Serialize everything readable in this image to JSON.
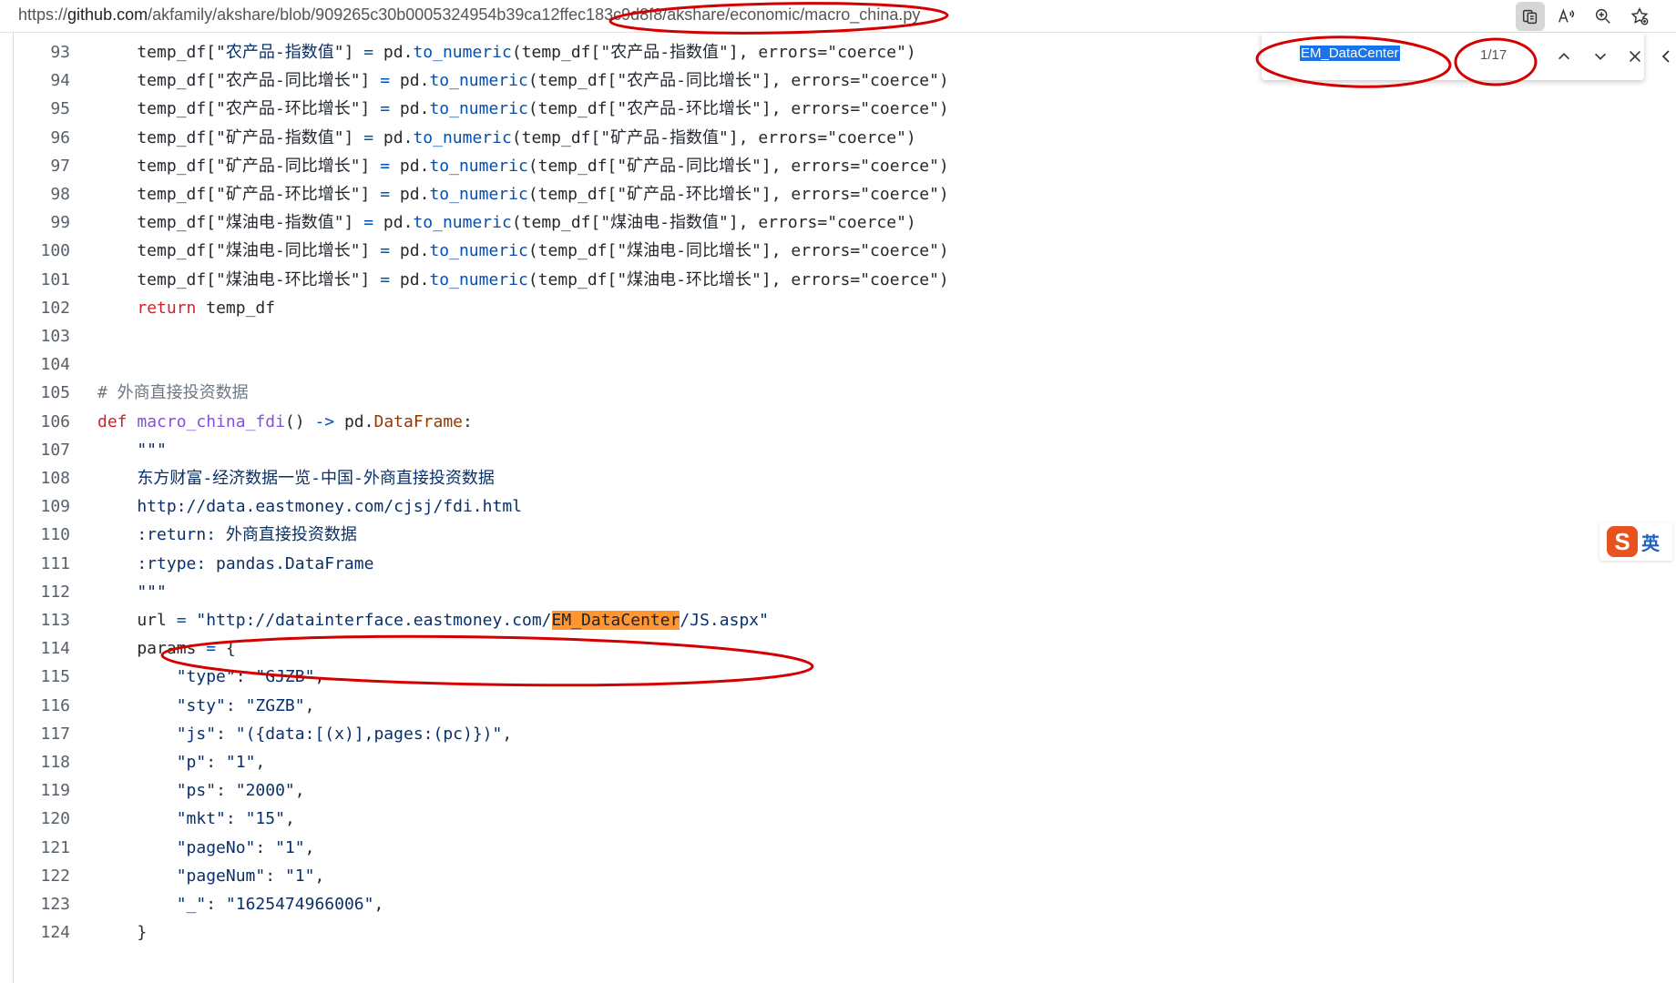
{
  "browser": {
    "url_scheme": "https://",
    "url_host": "github.com",
    "url_path": "/akfamily/akshare/blob/909265c30b0005324954b39ca12ffec183c9d8f8/akshare/economic/macro_china.py",
    "icons": [
      "reader-mode-icon",
      "read-aloud-icon",
      "zoom-icon",
      "favorite-add-icon"
    ]
  },
  "find": {
    "query": "EM_DataCenter",
    "count": "1/17"
  },
  "ime": {
    "logo": "S",
    "lang": "英"
  },
  "colors": {
    "keyword": "#cf222e",
    "function": "#8250df",
    "builtin": "#0550ae",
    "string": "#0a3069",
    "match_highlight": "#ff9632",
    "annotation": "#d40000"
  },
  "code": [
    {
      "n": "93",
      "t": [
        [
          "",
          "    temp_df[\""
        ],
        [
          "str",
          "农产品-指数值"
        ],
        [
          "",
          "\"] "
        ],
        [
          "op",
          "="
        ],
        [
          "",
          " pd."
        ],
        [
          "bi",
          "to_numeric"
        ],
        [
          "",
          "(temp_df[\"农产品-指数值\"], errors=\"coerce\")"
        ]
      ]
    },
    {
      "n": "94",
      "t": [
        [
          "",
          "    temp_df[\"农产品-同比增长\"] "
        ],
        [
          "op",
          "="
        ],
        [
          "",
          " pd."
        ],
        [
          "bi",
          "to_numeric"
        ],
        [
          "",
          "(temp_df[\"农产品-同比增长\"], errors=\"coerce\")"
        ]
      ]
    },
    {
      "n": "95",
      "t": [
        [
          "",
          "    temp_df[\"农产品-环比增长\"] "
        ],
        [
          "op",
          "="
        ],
        [
          "",
          " pd."
        ],
        [
          "bi",
          "to_numeric"
        ],
        [
          "",
          "(temp_df[\"农产品-环比增长\"], errors=\"coerce\")"
        ]
      ]
    },
    {
      "n": "96",
      "t": [
        [
          "",
          "    temp_df[\"矿产品-指数值\"] "
        ],
        [
          "op",
          "="
        ],
        [
          "",
          " pd."
        ],
        [
          "bi",
          "to_numeric"
        ],
        [
          "",
          "(temp_df[\"矿产品-指数值\"], errors=\"coerce\")"
        ]
      ]
    },
    {
      "n": "97",
      "t": [
        [
          "",
          "    temp_df[\"矿产品-同比增长\"] "
        ],
        [
          "op",
          "="
        ],
        [
          "",
          " pd."
        ],
        [
          "bi",
          "to_numeric"
        ],
        [
          "",
          "(temp_df[\"矿产品-同比增长\"], errors=\"coerce\")"
        ]
      ]
    },
    {
      "n": "98",
      "t": [
        [
          "",
          "    temp_df[\"矿产品-环比增长\"] "
        ],
        [
          "op",
          "="
        ],
        [
          "",
          " pd."
        ],
        [
          "bi",
          "to_numeric"
        ],
        [
          "",
          "(temp_df[\"矿产品-环比增长\"], errors=\"coerce\")"
        ]
      ]
    },
    {
      "n": "99",
      "t": [
        [
          "",
          "    temp_df[\"煤油电-指数值\"] "
        ],
        [
          "op",
          "="
        ],
        [
          "",
          " pd."
        ],
        [
          "bi",
          "to_numeric"
        ],
        [
          "",
          "(temp_df[\"煤油电-指数值\"], errors=\"coerce\")"
        ]
      ]
    },
    {
      "n": "100",
      "t": [
        [
          "",
          "    temp_df[\"煤油电-同比增长\"] "
        ],
        [
          "op",
          "="
        ],
        [
          "",
          " pd."
        ],
        [
          "bi",
          "to_numeric"
        ],
        [
          "",
          "(temp_df[\"煤油电-同比增长\"], errors=\"coerce\")"
        ]
      ]
    },
    {
      "n": "101",
      "t": [
        [
          "",
          "    temp_df[\"煤油电-环比增长\"] "
        ],
        [
          "op",
          "="
        ],
        [
          "",
          " pd."
        ],
        [
          "bi",
          "to_numeric"
        ],
        [
          "",
          "(temp_df[\"煤油电-环比增长\"], errors=\"coerce\")"
        ]
      ]
    },
    {
      "n": "102",
      "t": [
        [
          "",
          "    "
        ],
        [
          "kw",
          "return"
        ],
        [
          "",
          " temp_df"
        ]
      ]
    },
    {
      "n": "103",
      "t": []
    },
    {
      "n": "104",
      "t": []
    },
    {
      "n": "105",
      "t": [
        [
          "com",
          "# 外商直接投资数据"
        ]
      ]
    },
    {
      "n": "106",
      "t": [
        [
          "kw",
          "def"
        ],
        [
          "",
          " "
        ],
        [
          "fn",
          "macro_china_fdi"
        ],
        [
          "",
          "() "
        ],
        [
          "op",
          "->"
        ],
        [
          "",
          " pd."
        ],
        [
          "cls",
          "DataFrame"
        ],
        [
          "",
          ":"
        ]
      ]
    },
    {
      "n": "107",
      "t": [
        [
          "str",
          "    \"\"\""
        ]
      ]
    },
    {
      "n": "108",
      "t": [
        [
          "str",
          "    东方财富-经济数据一览-中国-外商直接投资数据"
        ]
      ]
    },
    {
      "n": "109",
      "t": [
        [
          "str",
          "    http://data.eastmoney.com/cjsj/fdi.html"
        ]
      ]
    },
    {
      "n": "110",
      "t": [
        [
          "str",
          "    :return: 外商直接投资数据"
        ]
      ]
    },
    {
      "n": "111",
      "t": [
        [
          "str",
          "    :rtype: pandas.DataFrame"
        ]
      ]
    },
    {
      "n": "112",
      "t": [
        [
          "str",
          "    \"\"\""
        ]
      ]
    },
    {
      "n": "113",
      "t": [
        [
          "",
          "    url "
        ],
        [
          "op",
          "="
        ],
        [
          "",
          " "
        ],
        [
          "str",
          "\"http://datainterface.eastmoney.com/"
        ],
        [
          "hl",
          "EM_DataCenter"
        ],
        [
          "str",
          "/JS.aspx\""
        ]
      ]
    },
    {
      "n": "114",
      "t": [
        [
          "",
          "    params "
        ],
        [
          "op",
          "="
        ],
        [
          "",
          " {"
        ]
      ]
    },
    {
      "n": "115",
      "t": [
        [
          "",
          "        "
        ],
        [
          "str",
          "\"type\""
        ],
        [
          "",
          ": "
        ],
        [
          "str",
          "\"GJZB\""
        ],
        [
          "",
          ","
        ]
      ]
    },
    {
      "n": "116",
      "t": [
        [
          "",
          "        "
        ],
        [
          "str",
          "\"sty\""
        ],
        [
          "",
          ": "
        ],
        [
          "str",
          "\"ZGZB\""
        ],
        [
          "",
          ","
        ]
      ]
    },
    {
      "n": "117",
      "t": [
        [
          "",
          "        "
        ],
        [
          "str",
          "\"js\""
        ],
        [
          "",
          ": "
        ],
        [
          "str",
          "\"({data:[(x)],pages:(pc)})\""
        ],
        [
          "",
          ","
        ]
      ]
    },
    {
      "n": "118",
      "t": [
        [
          "",
          "        "
        ],
        [
          "str",
          "\"p\""
        ],
        [
          "",
          ": "
        ],
        [
          "str",
          "\"1\""
        ],
        [
          "",
          ","
        ]
      ]
    },
    {
      "n": "119",
      "t": [
        [
          "",
          "        "
        ],
        [
          "str",
          "\"ps\""
        ],
        [
          "",
          ": "
        ],
        [
          "str",
          "\"2000\""
        ],
        [
          "",
          ","
        ]
      ]
    },
    {
      "n": "120",
      "t": [
        [
          "",
          "        "
        ],
        [
          "str",
          "\"mkt\""
        ],
        [
          "",
          ": "
        ],
        [
          "str",
          "\"15\""
        ],
        [
          "",
          ","
        ]
      ]
    },
    {
      "n": "121",
      "t": [
        [
          "",
          "        "
        ],
        [
          "str",
          "\"pageNo\""
        ],
        [
          "",
          ": "
        ],
        [
          "str",
          "\"1\""
        ],
        [
          "",
          ","
        ]
      ]
    },
    {
      "n": "122",
      "t": [
        [
          "",
          "        "
        ],
        [
          "str",
          "\"pageNum\""
        ],
        [
          "",
          ": "
        ],
        [
          "str",
          "\"1\""
        ],
        [
          "",
          ","
        ]
      ]
    },
    {
      "n": "123",
      "t": [
        [
          "",
          "        "
        ],
        [
          "str",
          "\"_\""
        ],
        [
          "",
          ": "
        ],
        [
          "str",
          "\"1625474966006\""
        ],
        [
          "",
          ","
        ]
      ]
    },
    {
      "n": "124",
      "t": [
        [
          "",
          "    }"
        ]
      ]
    }
  ]
}
